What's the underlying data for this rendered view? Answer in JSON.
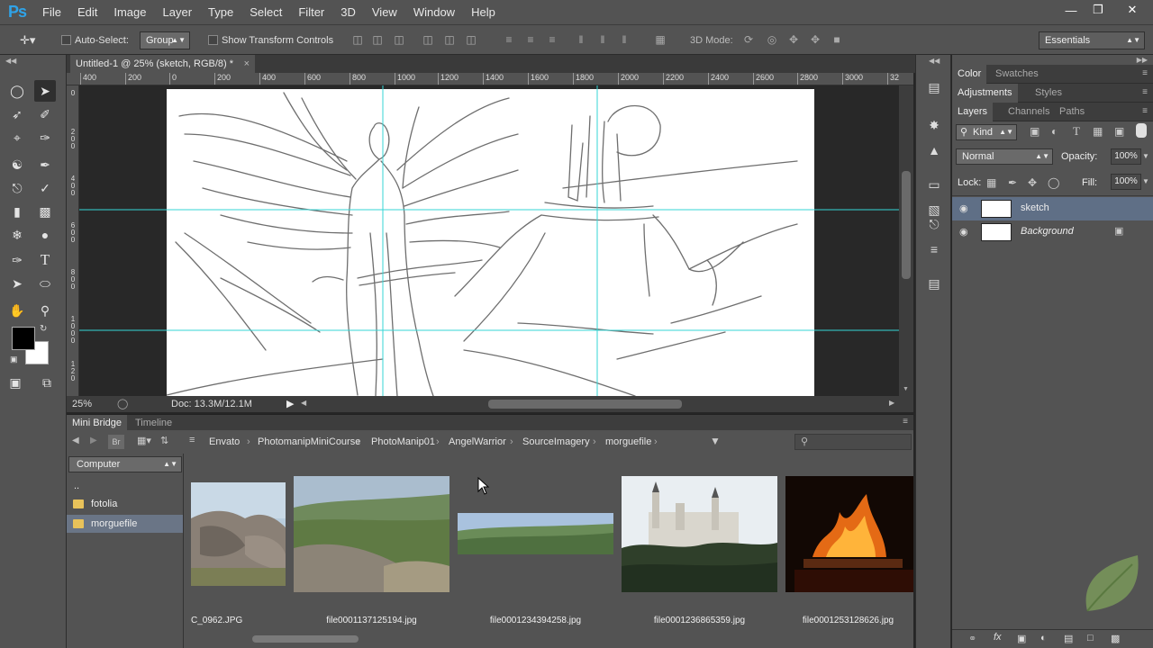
{
  "app": {
    "logo": "Ps"
  },
  "menu": [
    "File",
    "Edit",
    "Image",
    "Layer",
    "Type",
    "Select",
    "Filter",
    "3D",
    "View",
    "Window",
    "Help"
  ],
  "window_controls": [
    "minimize",
    "restore",
    "close"
  ],
  "options_bar": {
    "auto_select_label": "Auto-Select:",
    "auto_select_value": "Group",
    "transform_label": "Show Transform Controls",
    "mode_3d_label": "3D Mode:",
    "workspace": "Essentials"
  },
  "document": {
    "tab_title": "Untitled-1 @ 25% (sketch, RGB/8) *",
    "ruler_top": [
      "400",
      "200",
      "0",
      "200",
      "400",
      "600",
      "800",
      "1000",
      "1200",
      "1400",
      "1600",
      "1800",
      "2000",
      "2200",
      "2400",
      "2600",
      "2800",
      "3000",
      "32"
    ],
    "ruler_left": [
      "0",
      "2 0 0",
      "4 0 0",
      "6 0 0",
      "8 0 0",
      "1 0 0 0",
      "1 2 0"
    ],
    "zoom": "25%",
    "doc_info": "Doc: 13.3M/12.1M"
  },
  "mini_bridge": {
    "tabs": [
      "Mini Bridge",
      "Timeline"
    ],
    "breadcrumb": [
      "Envato",
      "PhotomanipMiniCourse",
      "PhotoManip01",
      "AngelWarrior",
      "SourceImagery",
      "morguefile"
    ],
    "location": "Computer",
    "folders": [
      "..",
      "fotolia",
      "morguefile"
    ],
    "selected_folder": "morguefile",
    "files": [
      "C_0962.JPG",
      "file0001137125194.jpg",
      "file0001234394258.jpg",
      "file0001236865359.jpg",
      "file0001253128626.jpg"
    ]
  },
  "panels": {
    "tabs_row1": [
      "Color",
      "Swatches"
    ],
    "tabs_row2": [
      "Adjustments",
      "Styles"
    ],
    "tabs_row3": [
      "Layers",
      "Channels",
      "Paths"
    ],
    "filter_kind": "Kind",
    "blend_mode": "Normal",
    "opacity_label": "Opacity:",
    "opacity_value": "100%",
    "lock_label": "Lock:",
    "fill_label": "Fill:",
    "fill_value": "100%",
    "layers": [
      {
        "name": "sketch",
        "selected": true
      },
      {
        "name": "Background",
        "selected": false,
        "locked": true
      }
    ]
  },
  "colors": {
    "accent_guide": "#35d6d6",
    "selected_row": "#5f6f86",
    "ps_blue": "#2fa3e8"
  }
}
